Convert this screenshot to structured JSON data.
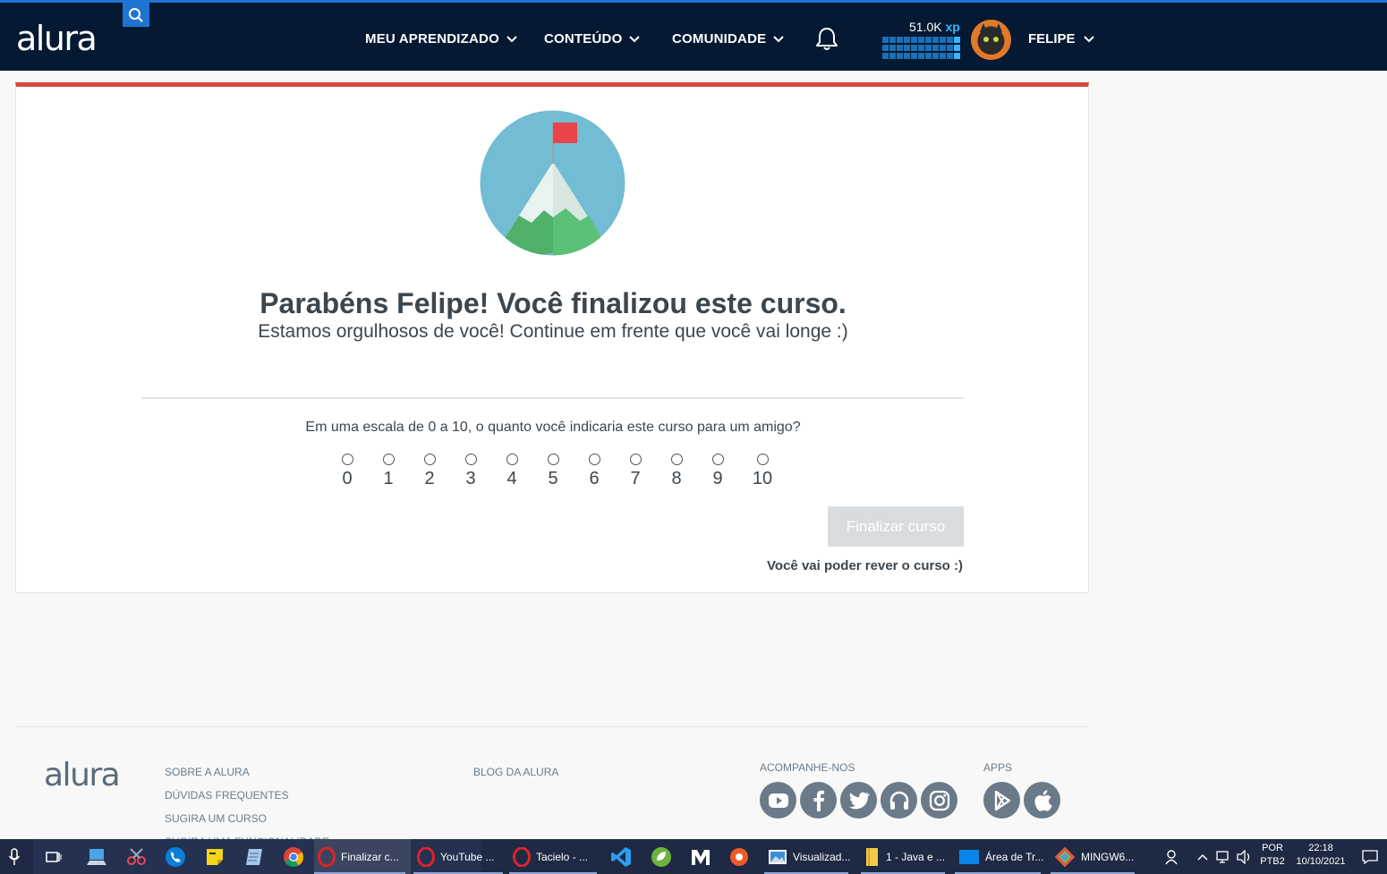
{
  "nav": {
    "logo": "alura",
    "items": [
      {
        "label": "MEU APRENDIZADO"
      },
      {
        "label": "CONTEÚDO"
      },
      {
        "label": "COMUNIDADE"
      }
    ],
    "xp_value": "51.0K",
    "xp_unit": "xp",
    "user": "FELIPE"
  },
  "card": {
    "title": "Parabéns Felipe! Você finalizou este curso.",
    "subtitle": "Estamos orgulhosos de você! Continue em frente que você vai longe :)",
    "question": "Em uma escala de 0 a 10, o quanto você indicaria este curso para um amigo?",
    "scale": [
      "0",
      "1",
      "2",
      "3",
      "4",
      "5",
      "6",
      "7",
      "8",
      "9",
      "10"
    ],
    "button": "Finalizar curso",
    "note": "Você vai poder rever o curso :)"
  },
  "footer": {
    "logo": "alura",
    "links_col1": [
      "SOBRE A ALURA",
      "DÚVIDAS FREQUENTES",
      "SUGIRA UM CURSO",
      "SUGIRA UMA FUNCIONALIDADE"
    ],
    "links_col2": [
      "BLOG DA ALURA"
    ],
    "follow_head": "ACOMPANHE-NOS",
    "apps_head": "APPS"
  },
  "taskbar": {
    "windows": [
      {
        "label": "Finalizar c..."
      },
      {
        "label": "YouTube ..."
      },
      {
        "label": "Tacielo - ..."
      },
      {
        "label": "Visualizad..."
      },
      {
        "label": "1 - Java e ..."
      },
      {
        "label": "Área de Tr..."
      },
      {
        "label": "MINGW6..."
      }
    ],
    "lang1": "POR",
    "lang2": "PTB2",
    "time": "22:18",
    "date": "10/10/2021"
  },
  "colors": {
    "navbar": "#051933",
    "accent_blue": "#1f74d1",
    "card_top_border": "#d4493f",
    "button_disabled": "#d8dce0"
  }
}
